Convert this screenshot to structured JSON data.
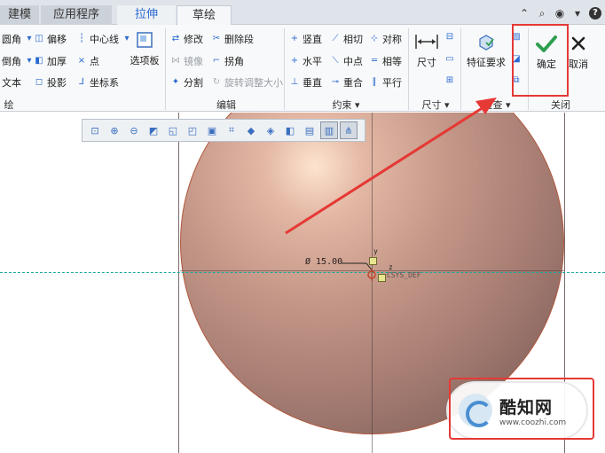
{
  "tabs": [
    {
      "label": "建模"
    },
    {
      "label": "应用程序"
    },
    {
      "label": "拉伸"
    },
    {
      "label": "草绘"
    }
  ],
  "ribbon": {
    "setup": {
      "items": [
        "圆角",
        "倒角",
        "文本",
        "偏移",
        "加厚",
        "投影",
        "中心线",
        "点",
        "坐标系"
      ],
      "palette_label": "选项板",
      "group_label": "绘"
    },
    "edit": {
      "items": [
        "修改",
        "删除段",
        "镜像",
        "拐角",
        "分割",
        "旋转调整大小"
      ],
      "group_label": "编辑"
    },
    "constrain": {
      "items": [
        "竖直",
        "相切",
        "对称",
        "水平",
        "中点",
        "相等",
        "垂直",
        "重合",
        "平行"
      ],
      "group_label": "约束"
    },
    "dimension": {
      "label": "尺寸",
      "group_label": "尺寸"
    },
    "inspect": {
      "label": "特征要求",
      "group_label": "检查"
    },
    "close": {
      "ok_label": "确定",
      "cancel_label": "取消",
      "group_label": "关闭"
    }
  },
  "canvas": {
    "dimension_text": "Ø 15.00",
    "csys_text": "CSYS_DEF",
    "axis_y": "y",
    "axis_z": "z"
  },
  "watermark": {
    "title": "酷知网",
    "url": "www.coozhi.com"
  },
  "colors": {
    "accent": "#2a6ad0",
    "confirm": "#2e9e4f",
    "highlight": "#e53935",
    "datum": "#1aa99b"
  }
}
